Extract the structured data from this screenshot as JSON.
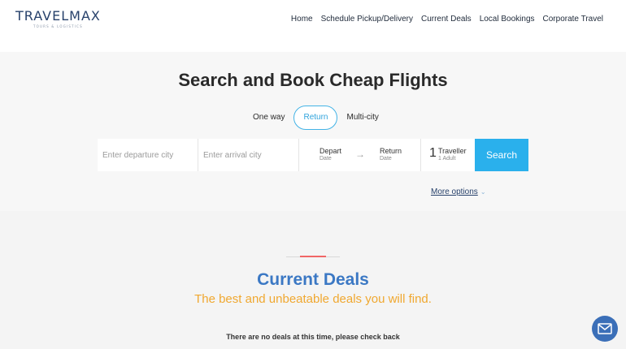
{
  "brand": {
    "name": "TRAVELMAX",
    "tagline": "TOURS & LOGISTICS"
  },
  "nav": {
    "items": [
      {
        "label": "Home"
      },
      {
        "label": "Schedule Pickup/Delivery"
      },
      {
        "label": "Current Deals"
      },
      {
        "label": "Local Bookings"
      },
      {
        "label": "Corporate Travel"
      }
    ]
  },
  "search": {
    "title": "Search and Book Cheap Flights",
    "trip_types": [
      {
        "label": "One way",
        "active": false
      },
      {
        "label": "Return",
        "active": true
      },
      {
        "label": "Multi-city",
        "active": false
      }
    ],
    "departure_placeholder": "Enter departure city",
    "arrival_placeholder": "Enter arrival city",
    "depart_label": "Depart",
    "depart_sub": "Date",
    "return_label": "Return",
    "return_sub": "Date",
    "traveller_count": "1",
    "traveller_label": "Traveller",
    "traveller_sub": "1 Adult",
    "search_button": "Search",
    "more_options": "More options"
  },
  "deals": {
    "title": "Current Deals",
    "subtitle": "The best and unbeatable deals you will find.",
    "empty_message": "There are no deals at this time, please check back"
  },
  "colors": {
    "accent": "#2ab0ec",
    "brand_blue": "#27416b",
    "deals_title": "#3b78c4",
    "deals_subtitle": "#f0a830",
    "divider_accent": "#f06666",
    "mail_button": "#3b6fb8"
  },
  "icons": {
    "support": "headset-icon",
    "arrow": "arrow-right-icon",
    "chevron": "chevron-down-icon",
    "mail": "mail-icon"
  }
}
